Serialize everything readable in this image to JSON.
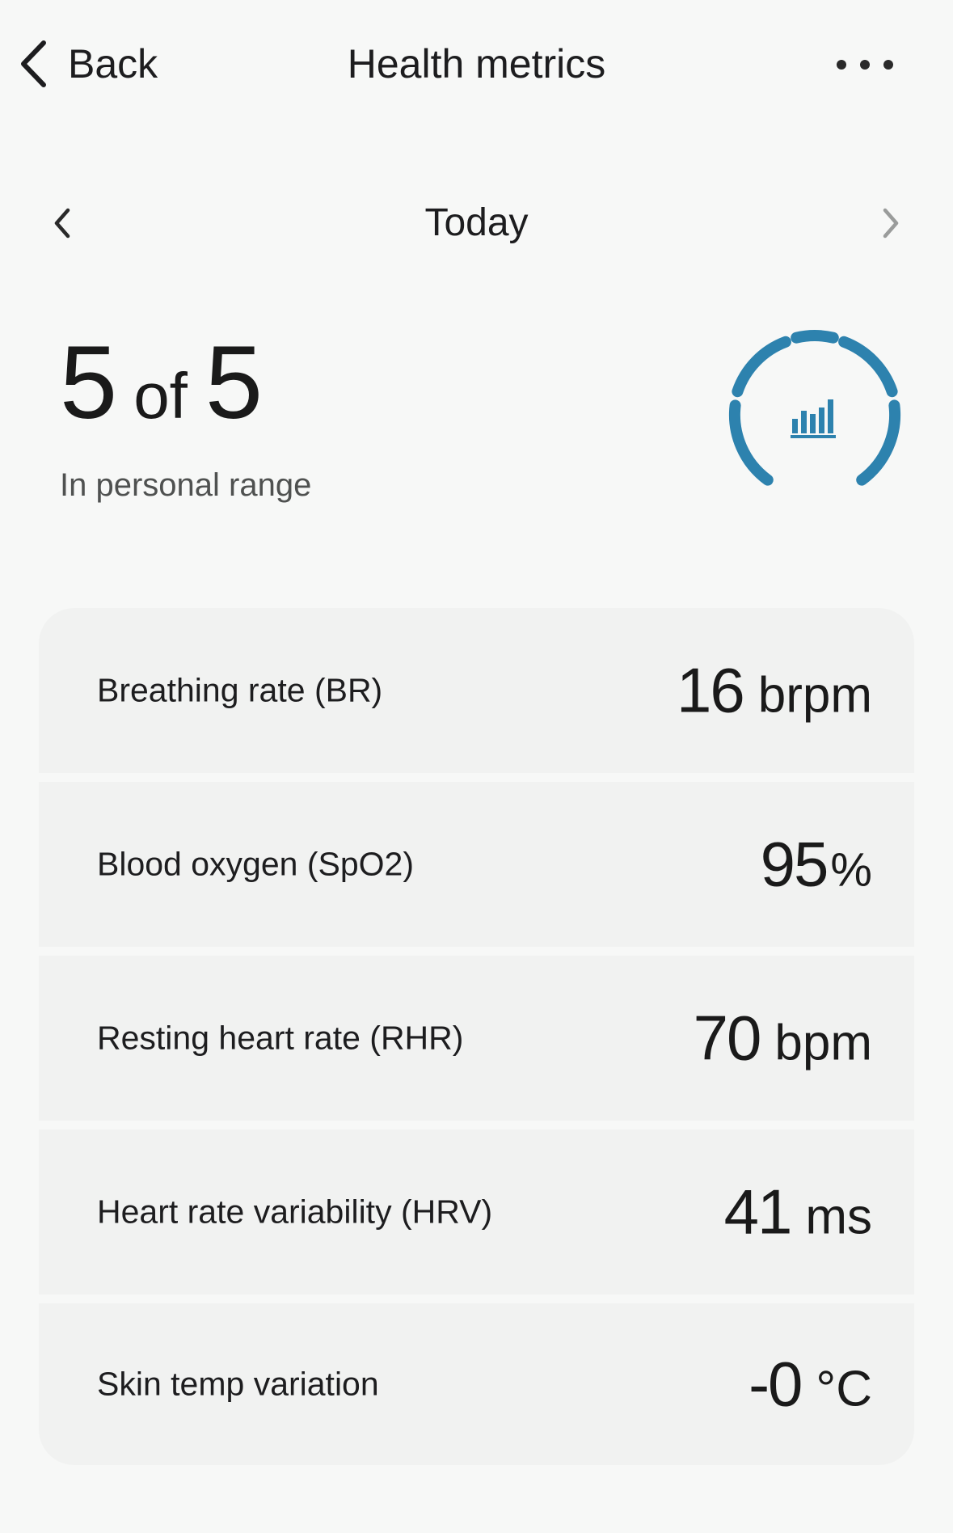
{
  "header": {
    "back_label": "Back",
    "title": "Health metrics"
  },
  "date_nav": {
    "label": "Today"
  },
  "summary": {
    "in_range": "5",
    "of_word": "of",
    "total": "5",
    "subtitle": "In personal range",
    "gauge_color": "#2d82ae"
  },
  "metrics": [
    {
      "label": "Breathing rate (BR)",
      "value": "16",
      "unit": "brpm"
    },
    {
      "label": "Blood oxygen (SpO2)",
      "value": "95",
      "unit": "%"
    },
    {
      "label": "Resting heart rate (RHR)",
      "value": "70",
      "unit": "bpm"
    },
    {
      "label": "Heart rate variability (HRV)",
      "value": "41",
      "unit": "ms"
    },
    {
      "label": "Skin temp variation",
      "value": "-0",
      "unit": "°C"
    }
  ],
  "icons": {
    "back": "chevron-left-icon",
    "more": "more-horizontal-icon",
    "prev": "chevron-left-icon",
    "next": "chevron-right-icon",
    "gauge": "bar-chart-icon"
  }
}
